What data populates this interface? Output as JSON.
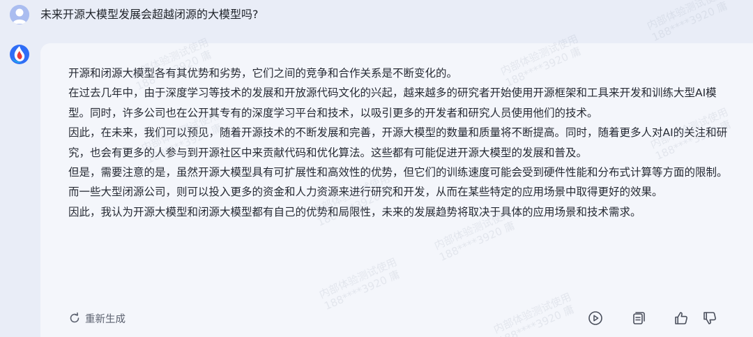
{
  "question": {
    "text": "未来开源大模型发展会超越闭源的大模型吗?"
  },
  "answer": {
    "paragraphs": [
      "开源和闭源大模型各有其优势和劣势，它们之间的竞争和合作关系是不断变化的。",
      "在过去几年中，由于深度学习等技术的发展和开放源代码文化的兴起，越来越多的研究者开始使用开源框架和工具来开发和训练大型AI模型。同时，许多公司也在公开其专有的深度学习平台和技术，以吸引更多的开发者和研究人员使用他们的技术。",
      "因此，在未来，我们可以预见，随着开源技术的不断发展和完善，开源大模型的数量和质量将不断提高。同时，随着更多人对AI的关注和研究，也会有更多的人参与到开源社区中来贡献代码和优化算法。这些都有可能促进开源大模型的发展和普及。",
      "但是，需要注意的是，虽然开源大模型具有可扩展性和高效性的优势，但它们的训练速度可能会受到硬件性能和分布式计算等方面的限制。而一些大型闭源公司，则可以投入更多的资金和人力资源来进行研究和开发，从而在某些特定的应用场景中取得更好的效果。",
      "因此，我认为开源大模型和闭源大模型都有自己的优势和局限性，未来的发展趋势将取决于具体的应用场景和技术需求。"
    ]
  },
  "footer": {
    "regenerate_label": "重新生成"
  },
  "watermark": {
    "line1": "内部体验测试使用",
    "line2": "188****3920 庸"
  },
  "colors": {
    "page_bg": "#e9edf7",
    "card_bg": "#f4f6fb",
    "text": "#262a33",
    "icon": "#4a4f5c"
  }
}
